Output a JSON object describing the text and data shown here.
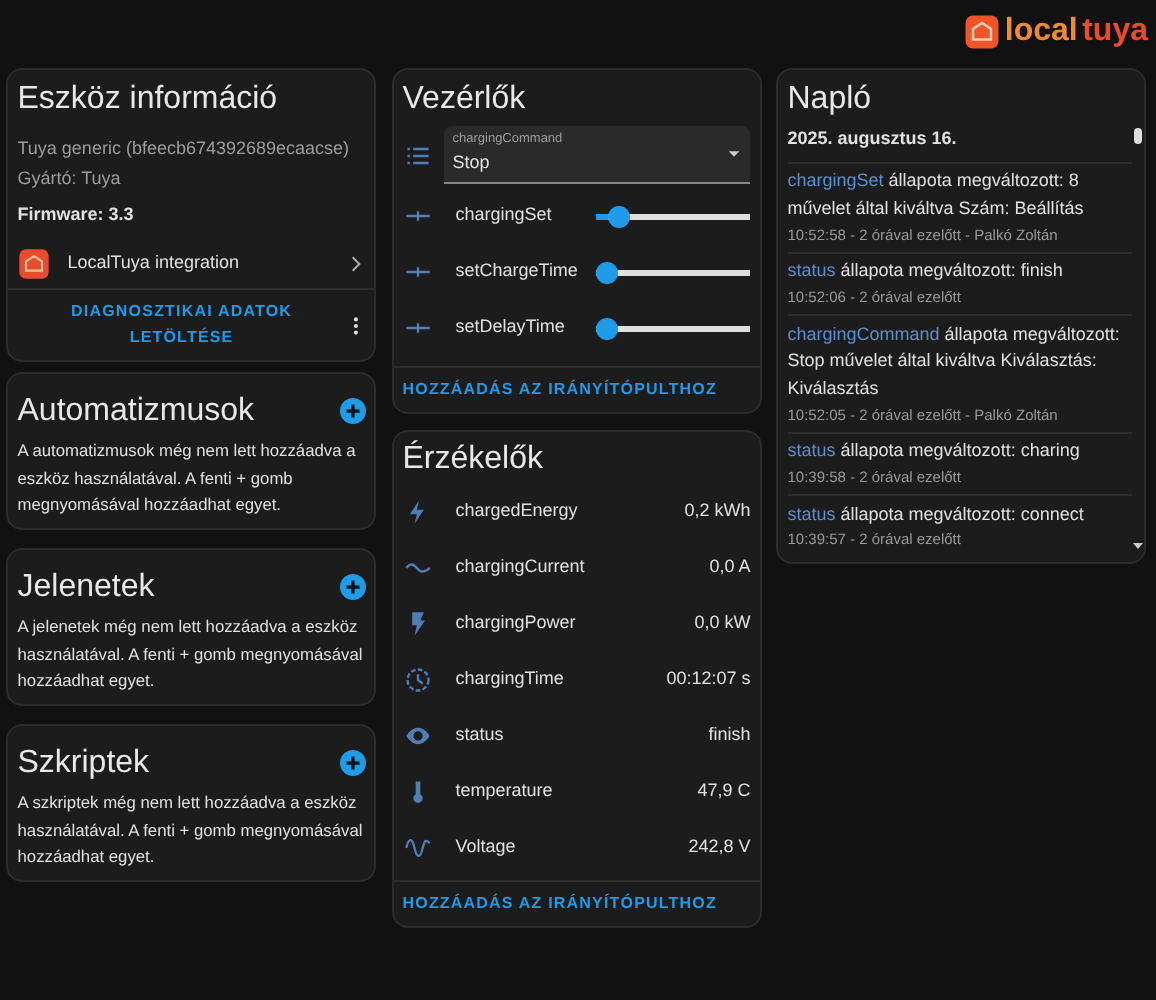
{
  "logo": {
    "words": [
      "local",
      "tuya"
    ]
  },
  "device_info": {
    "title": "Eszköz információ",
    "model": "Tuya generic (bfeecb674392689ecaacse)",
    "manufacturer": "Gyártó: Tuya",
    "firmware": "Firmware: 3.3",
    "integration": "LocalTuya integration",
    "action": "DIAGNOSZTIKAI ADATOK LETÖLTÉSE"
  },
  "empty_cards": [
    {
      "title": "Automatizmusok",
      "text": "A automatizmusok még nem lett hozzáadva a eszköz használatával. A fenti + gomb megnyomásával hozzáadhat egyet."
    },
    {
      "title": "Jelenetek",
      "text": "A jelenetek még nem lett hozzáadva a eszköz használatával. A fenti + gomb megnyomásával hozzáadhat egyet."
    },
    {
      "title": "Szkriptek",
      "text": "A szkriptek még nem lett hozzáadva a eszköz használatával. A fenti + gomb megnyomásával hozzáadhat egyet."
    }
  ],
  "controls": {
    "title": "Vezérlők",
    "select": {
      "label": "chargingCommand",
      "value": "Stop"
    },
    "sliders": [
      {
        "name": "chargingSet",
        "level": 0.08
      },
      {
        "name": "setChargeTime",
        "level": 0
      },
      {
        "name": "setDelayTime",
        "level": 0
      }
    ],
    "action": "HOZZÁADÁS AZ IRÁNYÍTÓPULTHOZ"
  },
  "sensors": {
    "title": "Érzékelők",
    "rows": [
      {
        "name": "chargedEnergy",
        "value": "0,2 kWh"
      },
      {
        "name": "chargingCurrent",
        "value": "0,0 A"
      },
      {
        "name": "chargingPower",
        "value": "0,0 kW"
      },
      {
        "name": "chargingTime",
        "value": "00:12:07 s"
      },
      {
        "name": "status",
        "value": "finish"
      },
      {
        "name": "temperature",
        "value": "47,9 C"
      },
      {
        "name": "Voltage",
        "value": "242,8 V"
      }
    ],
    "action": "HOZZÁADÁS AZ IRÁNYÍTÓPULTHOZ"
  },
  "log": {
    "title": "Napló",
    "date": "2025. augusztus 16.",
    "entries": [
      {
        "entity": "chargingSet",
        "message": "állapota megváltozott: 8 művelet által kiváltva Szám: Beállítás",
        "time": "10:52:58 - 2 órával ezelőtt - Palkó Zoltán"
      },
      {
        "entity": "status",
        "message": "állapota megváltozott: finish",
        "time": "10:52:06 - 2 órával ezelőtt"
      },
      {
        "entity": "chargingCommand",
        "message": "állapota megváltozott: Stop művelet által kiváltva Kiválasztás: Kiválasztás",
        "time": "10:52:05 - 2 órával ezelőtt - Palkó Zoltán"
      },
      {
        "entity": "status",
        "message": "állapota megváltozott: charing",
        "time": "10:39:58 - 2 órával ezelőtt"
      },
      {
        "entity": "status",
        "message": "állapota megváltozott: connect",
        "time": "10:39:57 - 2 órával ezelőtt"
      }
    ]
  }
}
